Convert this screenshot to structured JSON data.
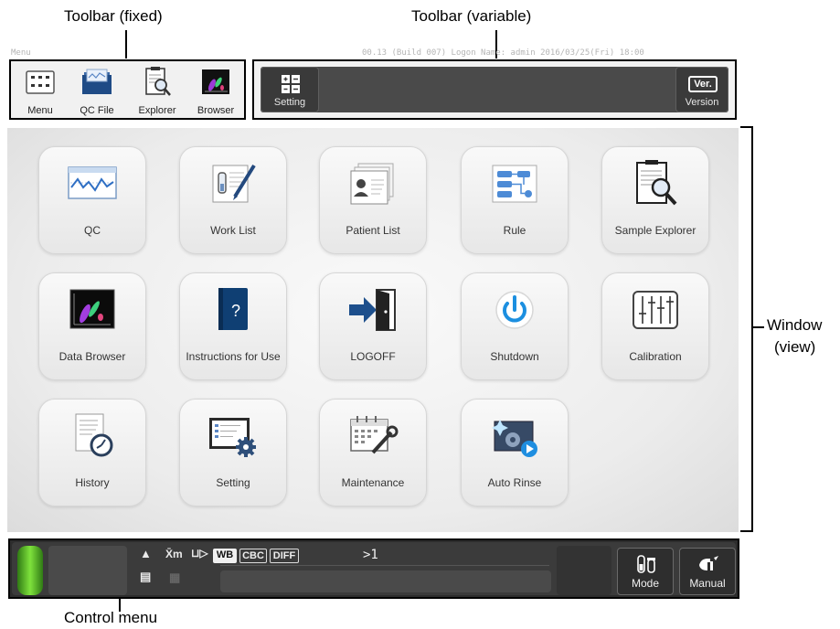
{
  "callouts": {
    "toolbar_fixed": "Toolbar (fixed)",
    "toolbar_variable": "Toolbar (variable)",
    "window_line1": "Window",
    "window_line2": "(view)",
    "control_menu": "Control menu"
  },
  "status_line": {
    "left": "Menu",
    "right": "00.13 (Build 007)  Logon Name: admin   2016/03/25(Fri) 18:00"
  },
  "toolbar_fixed": {
    "items": [
      {
        "label": "Menu",
        "icon": "menu-grid-icon"
      },
      {
        "label": "QC File",
        "icon": "qc-file-icon"
      },
      {
        "label": "Explorer",
        "icon": "explorer-icon"
      },
      {
        "label": "Browser",
        "icon": "browser-icon"
      }
    ]
  },
  "toolbar_variable": {
    "setting_label": "Setting",
    "version_label": "Version",
    "version_badge": "Ver."
  },
  "menu_tiles": [
    {
      "label": "QC",
      "icon": "qc-chart-icon"
    },
    {
      "label": "Work List",
      "icon": "work-list-icon"
    },
    {
      "label": "Patient List",
      "icon": "patient-list-icon"
    },
    {
      "label": "Rule",
      "icon": "rule-icon"
    },
    {
      "label": "Sample Explorer",
      "icon": "sample-explorer-icon"
    },
    {
      "label": "Data Browser",
      "icon": "data-browser-icon"
    },
    {
      "label": "Instructions for Use",
      "icon": "instructions-book-icon"
    },
    {
      "label": "LOGOFF",
      "icon": "logoff-door-icon"
    },
    {
      "label": "Shutdown",
      "icon": "power-icon"
    },
    {
      "label": "Calibration",
      "icon": "calibration-sliders-icon"
    },
    {
      "label": "History",
      "icon": "history-icon"
    },
    {
      "label": "Setting",
      "icon": "setting-gear-icon"
    },
    {
      "label": "Maintenance",
      "icon": "maintenance-calendar-icon"
    },
    {
      "label": "Auto Rinse",
      "icon": "auto-rinse-icon"
    }
  ],
  "control_menu": {
    "mode_wb": "WB",
    "mode_cbc": "CBC",
    "mode_diff": "DIFF",
    "xm_label": "X̄m",
    "sample_text": ">1",
    "mode_button_label": "Mode",
    "manual_button_label": "Manual",
    "colors": {
      "led": "#6fd63a",
      "panel": "#3b3b3b"
    }
  }
}
